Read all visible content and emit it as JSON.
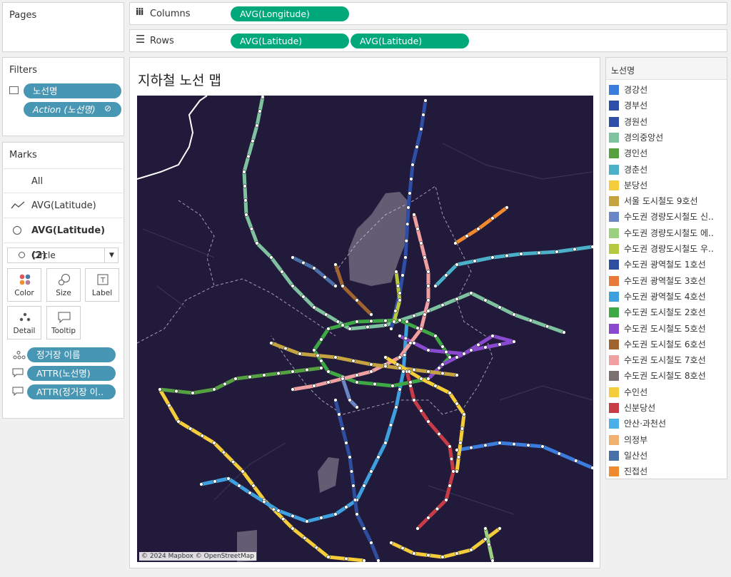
{
  "pages": {
    "title": "Pages"
  },
  "columns": {
    "label": "Columns",
    "pill": "AVG(Longitude)"
  },
  "rows": {
    "label": "Rows",
    "pills": [
      "AVG(Latitude)",
      "AVG(Latitude)"
    ]
  },
  "filters": {
    "title": "Filters",
    "pills": [
      "노선명",
      "Action (노선명)"
    ]
  },
  "marks": {
    "title": "Marks",
    "layers": [
      "All",
      "AVG(Latitude)",
      "AVG(Latitude) (2)"
    ],
    "mark_type": "Circle",
    "buttons": [
      "Color",
      "Size",
      "Label",
      "Detail",
      "Tooltip"
    ],
    "fields": [
      "정거장 이름",
      "ATTR(노선명)",
      "ATTR(정거장 이.."
    ]
  },
  "viz": {
    "title": "지하철 노선 맵",
    "attribution": "© 2024 Mapbox © OpenStreetMap"
  },
  "legend": {
    "title": "노선명",
    "items": [
      {
        "label": "경강선",
        "color": "#3b7ddd"
      },
      {
        "label": "경부선",
        "color": "#2f4ea8"
      },
      {
        "label": "경원선",
        "color": "#2f4ea8"
      },
      {
        "label": "경의중앙선",
        "color": "#7fc2a0"
      },
      {
        "label": "경인선",
        "color": "#55a040"
      },
      {
        "label": "경춘선",
        "color": "#4bb0c8"
      },
      {
        "label": "분당선",
        "color": "#f5cd3a"
      },
      {
        "label": "서울 도시철도 9호선",
        "color": "#c5a340"
      },
      {
        "label": "수도권 경량도시철도 신..",
        "color": "#6b87c8"
      },
      {
        "label": "수도권 경량도시철도 에..",
        "color": "#9ad080"
      },
      {
        "label": "수도권 경량도시철도 우..",
        "color": "#b5c840"
      },
      {
        "label": "수도권 광역철도 1호선",
        "color": "#2e4ea0"
      },
      {
        "label": "수도권 광역철도 3호선",
        "color": "#e8793a"
      },
      {
        "label": "수도권 광역철도 4호선",
        "color": "#3fa0e0"
      },
      {
        "label": "수도권 도시철도 2호선",
        "color": "#3ea844"
      },
      {
        "label": "수도권 도시철도 5호선",
        "color": "#8a4ad0"
      },
      {
        "label": "수도권 도시철도 6호선",
        "color": "#a06430"
      },
      {
        "label": "수도권 도시철도 7호선",
        "color": "#f0a0a0"
      },
      {
        "label": "수도권 도시철도 8호선",
        "color": "#7a7070"
      },
      {
        "label": "수인선",
        "color": "#f5cd3a"
      },
      {
        "label": "신분당선",
        "color": "#c83c48"
      },
      {
        "label": "안산·과천선",
        "color": "#4bb0e8"
      },
      {
        "label": "의정부",
        "color": "#f0b070"
      },
      {
        "label": "일산선",
        "color": "#4a70a8"
      },
      {
        "label": "진접선",
        "color": "#f08a30"
      }
    ]
  },
  "map_lines": [
    {
      "color": "#7fc2a0",
      "pts": [
        [
          368,
          135
        ],
        [
          360,
          175
        ],
        [
          342,
          240
        ],
        [
          345,
          300
        ],
        [
          360,
          340
        ],
        [
          380,
          360
        ],
        [
          410,
          400
        ],
        [
          440,
          430
        ],
        [
          490,
          460
        ],
        [
          540,
          455
        ],
        [
          600,
          435
        ],
        [
          660,
          410
        ],
        [
          720,
          440
        ],
        [
          790,
          465
        ]
      ]
    },
    {
      "color": "#2f4ea8",
      "pts": [
        [
          596,
          140
        ],
        [
          590,
          180
        ],
        [
          578,
          230
        ],
        [
          572,
          290
        ],
        [
          568,
          360
        ],
        [
          560,
          410
        ],
        [
          548,
          460
        ]
      ]
    },
    {
      "color": "#f5cd3a",
      "pts": [
        [
          224,
          545
        ],
        [
          250,
          590
        ],
        [
          300,
          620
        ],
        [
          340,
          660
        ],
        [
          370,
          700
        ],
        [
          410,
          740
        ],
        [
          460,
          780
        ],
        [
          510,
          785
        ]
      ]
    },
    {
      "color": "#f5cd3a",
      "pts": [
        [
          548,
          760
        ],
        [
          580,
          775
        ],
        [
          620,
          780
        ],
        [
          660,
          770
        ],
        [
          700,
          740
        ]
      ]
    },
    {
      "color": "#3fa0e0",
      "pts": [
        [
          570,
          450
        ],
        [
          565,
          520
        ],
        [
          555,
          570
        ],
        [
          540,
          620
        ],
        [
          520,
          660
        ],
        [
          500,
          700
        ],
        [
          470,
          720
        ],
        [
          430,
          730
        ],
        [
          390,
          715
        ],
        [
          350,
          690
        ],
        [
          320,
          670
        ],
        [
          282,
          678
        ]
      ]
    },
    {
      "color": "#3ea844",
      "pts": [
        [
          460,
          460
        ],
        [
          500,
          450
        ],
        [
          560,
          448
        ],
        [
          610,
          470
        ],
        [
          630,
          500
        ],
        [
          600,
          530
        ],
        [
          550,
          540
        ],
        [
          500,
          535
        ],
        [
          460,
          520
        ],
        [
          440,
          490
        ],
        [
          460,
          460
        ]
      ]
    },
    {
      "color": "#55a040",
      "pts": [
        [
          224,
          545
        ],
        [
          270,
          550
        ],
        [
          300,
          545
        ],
        [
          330,
          530
        ],
        [
          370,
          525
        ],
        [
          410,
          520
        ],
        [
          450,
          515
        ]
      ]
    },
    {
      "color": "#c83c48",
      "pts": [
        [
          570,
          520
        ],
        [
          580,
          560
        ],
        [
          600,
          590
        ],
        [
          630,
          625
        ],
        [
          635,
          660
        ],
        [
          625,
          700
        ],
        [
          600,
          725
        ],
        [
          585,
          740
        ]
      ]
    },
    {
      "color": "#3b7ddd",
      "pts": [
        [
          640,
          630
        ],
        [
          700,
          620
        ],
        [
          760,
          625
        ],
        [
          830,
          655
        ]
      ]
    },
    {
      "color": "#4bb0c8",
      "pts": [
        [
          610,
          400
        ],
        [
          640,
          370
        ],
        [
          690,
          360
        ],
        [
          730,
          355
        ],
        [
          780,
          352
        ],
        [
          830,
          345
        ]
      ]
    },
    {
      "color": "#f08a30",
      "pts": [
        [
          638,
          340
        ],
        [
          670,
          320
        ],
        [
          710,
          290
        ]
      ]
    },
    {
      "color": "#8a4ad0",
      "pts": [
        [
          560,
          470
        ],
        [
          600,
          490
        ],
        [
          650,
          495
        ],
        [
          690,
          470
        ],
        [
          720,
          478
        ],
        [
          660,
          490
        ],
        [
          620,
          510
        ],
        [
          600,
          530
        ]
      ]
    },
    {
      "color": "#2e4ea0",
      "pts": [
        [
          470,
          560
        ],
        [
          480,
          600
        ],
        [
          490,
          640
        ],
        [
          495,
          680
        ],
        [
          500,
          720
        ],
        [
          520,
          760
        ],
        [
          530,
          785
        ]
      ]
    },
    {
      "color": "#f0a0a0",
      "pts": [
        [
          580,
          300
        ],
        [
          590,
          340
        ],
        [
          600,
          380
        ],
        [
          600,
          420
        ],
        [
          590,
          460
        ],
        [
          560,
          500
        ],
        [
          520,
          520
        ],
        [
          480,
          530
        ],
        [
          440,
          540
        ],
        [
          410,
          545
        ]
      ]
    },
    {
      "color": "#c5a340",
      "pts": [
        [
          380,
          480
        ],
        [
          420,
          495
        ],
        [
          470,
          500
        ],
        [
          520,
          510
        ],
        [
          560,
          515
        ],
        [
          600,
          520
        ],
        [
          640,
          525
        ]
      ]
    },
    {
      "color": "#a06430",
      "pts": [
        [
          470,
          370
        ],
        [
          480,
          400
        ],
        [
          500,
          420
        ],
        [
          520,
          440
        ]
      ]
    },
    {
      "color": "#f5cd3a",
      "pts": [
        [
          540,
          500
        ],
        [
          590,
          530
        ],
        [
          630,
          550
        ],
        [
          650,
          580
        ],
        [
          645,
          620
        ],
        [
          640,
          660
        ]
      ]
    },
    {
      "color": "#4a70a8",
      "pts": [
        [
          410,
          360
        ],
        [
          440,
          375
        ],
        [
          470,
          400
        ]
      ]
    },
    {
      "color": "#6b87c8",
      "pts": [
        [
          480,
          530
        ],
        [
          490,
          560
        ],
        [
          500,
          570
        ]
      ]
    },
    {
      "color": "#9ad080",
      "pts": [
        [
          680,
          740
        ],
        [
          690,
          785
        ]
      ]
    },
    {
      "color": "#b5c840",
      "pts": [
        [
          555,
          380
        ],
        [
          560,
          420
        ],
        [
          552,
          450
        ]
      ]
    }
  ]
}
